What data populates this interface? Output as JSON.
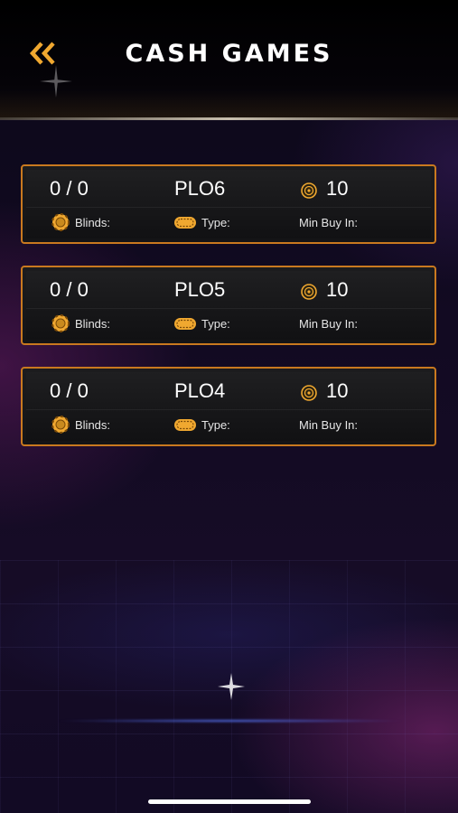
{
  "header": {
    "title": "CASH GAMES"
  },
  "colors": {
    "accent": "#c9791f",
    "gold": "#f0a830",
    "card_bg": "#1a1a1c"
  },
  "tables": [
    {
      "players": "0 / 0",
      "game": "PLO6",
      "buy_in": "10",
      "blinds_label": "Blinds:",
      "type_label": "Type:",
      "min_buy_in_label": "Min Buy In:"
    },
    {
      "players": "0 / 0",
      "game": "PLO5",
      "buy_in": "10",
      "blinds_label": "Blinds:",
      "type_label": "Type:",
      "min_buy_in_label": "Min Buy In:"
    },
    {
      "players": "0 / 0",
      "game": "PLO4",
      "buy_in": "10",
      "blinds_label": "Blinds:",
      "type_label": "Type:",
      "min_buy_in_label": "Min Buy In:"
    }
  ],
  "icons": {
    "back": "double-chevron-left-icon",
    "chip": "chip-icon",
    "table": "poker-table-icon",
    "coin": "coin-icon"
  }
}
